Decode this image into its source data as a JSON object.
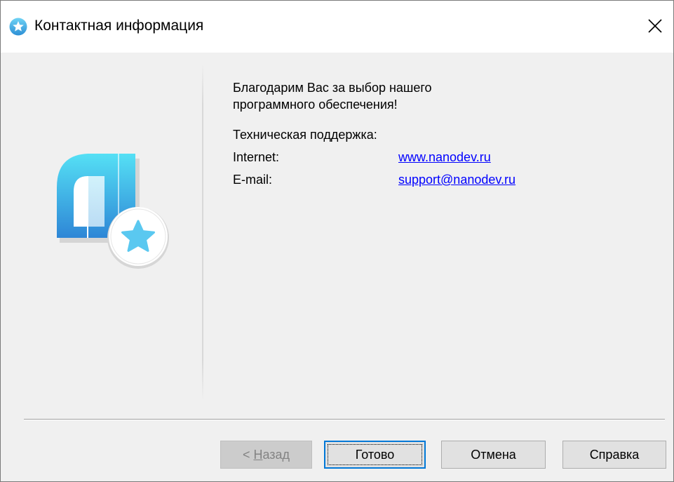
{
  "window": {
    "title": "Контактная информация"
  },
  "content": {
    "thanks_text": "Благодарим Вас за выбор нашего программного обеспечения!",
    "support_heading": "Техническая поддержка:",
    "contacts": [
      {
        "label": "Internet:",
        "value": "www.nanodev.ru"
      },
      {
        "label": "E-mail:",
        "value": "support@nanodev.ru"
      }
    ]
  },
  "buttons": {
    "back_prefix": "< ",
    "back_hotkey": "Н",
    "back_rest": "азад",
    "done_label": "Готово",
    "cancel_label": "Отмена",
    "help_label": "Справка"
  },
  "icons": {
    "title_icon": "star-badge-icon",
    "close_icon": "close-icon",
    "logo": "app-logo-icon"
  },
  "colors": {
    "accent": "#0078d7",
    "link": "#0000ff",
    "logo_top": "#4fd8f2",
    "logo_bottom": "#2f8fd8",
    "star": "#5ac8f0"
  }
}
